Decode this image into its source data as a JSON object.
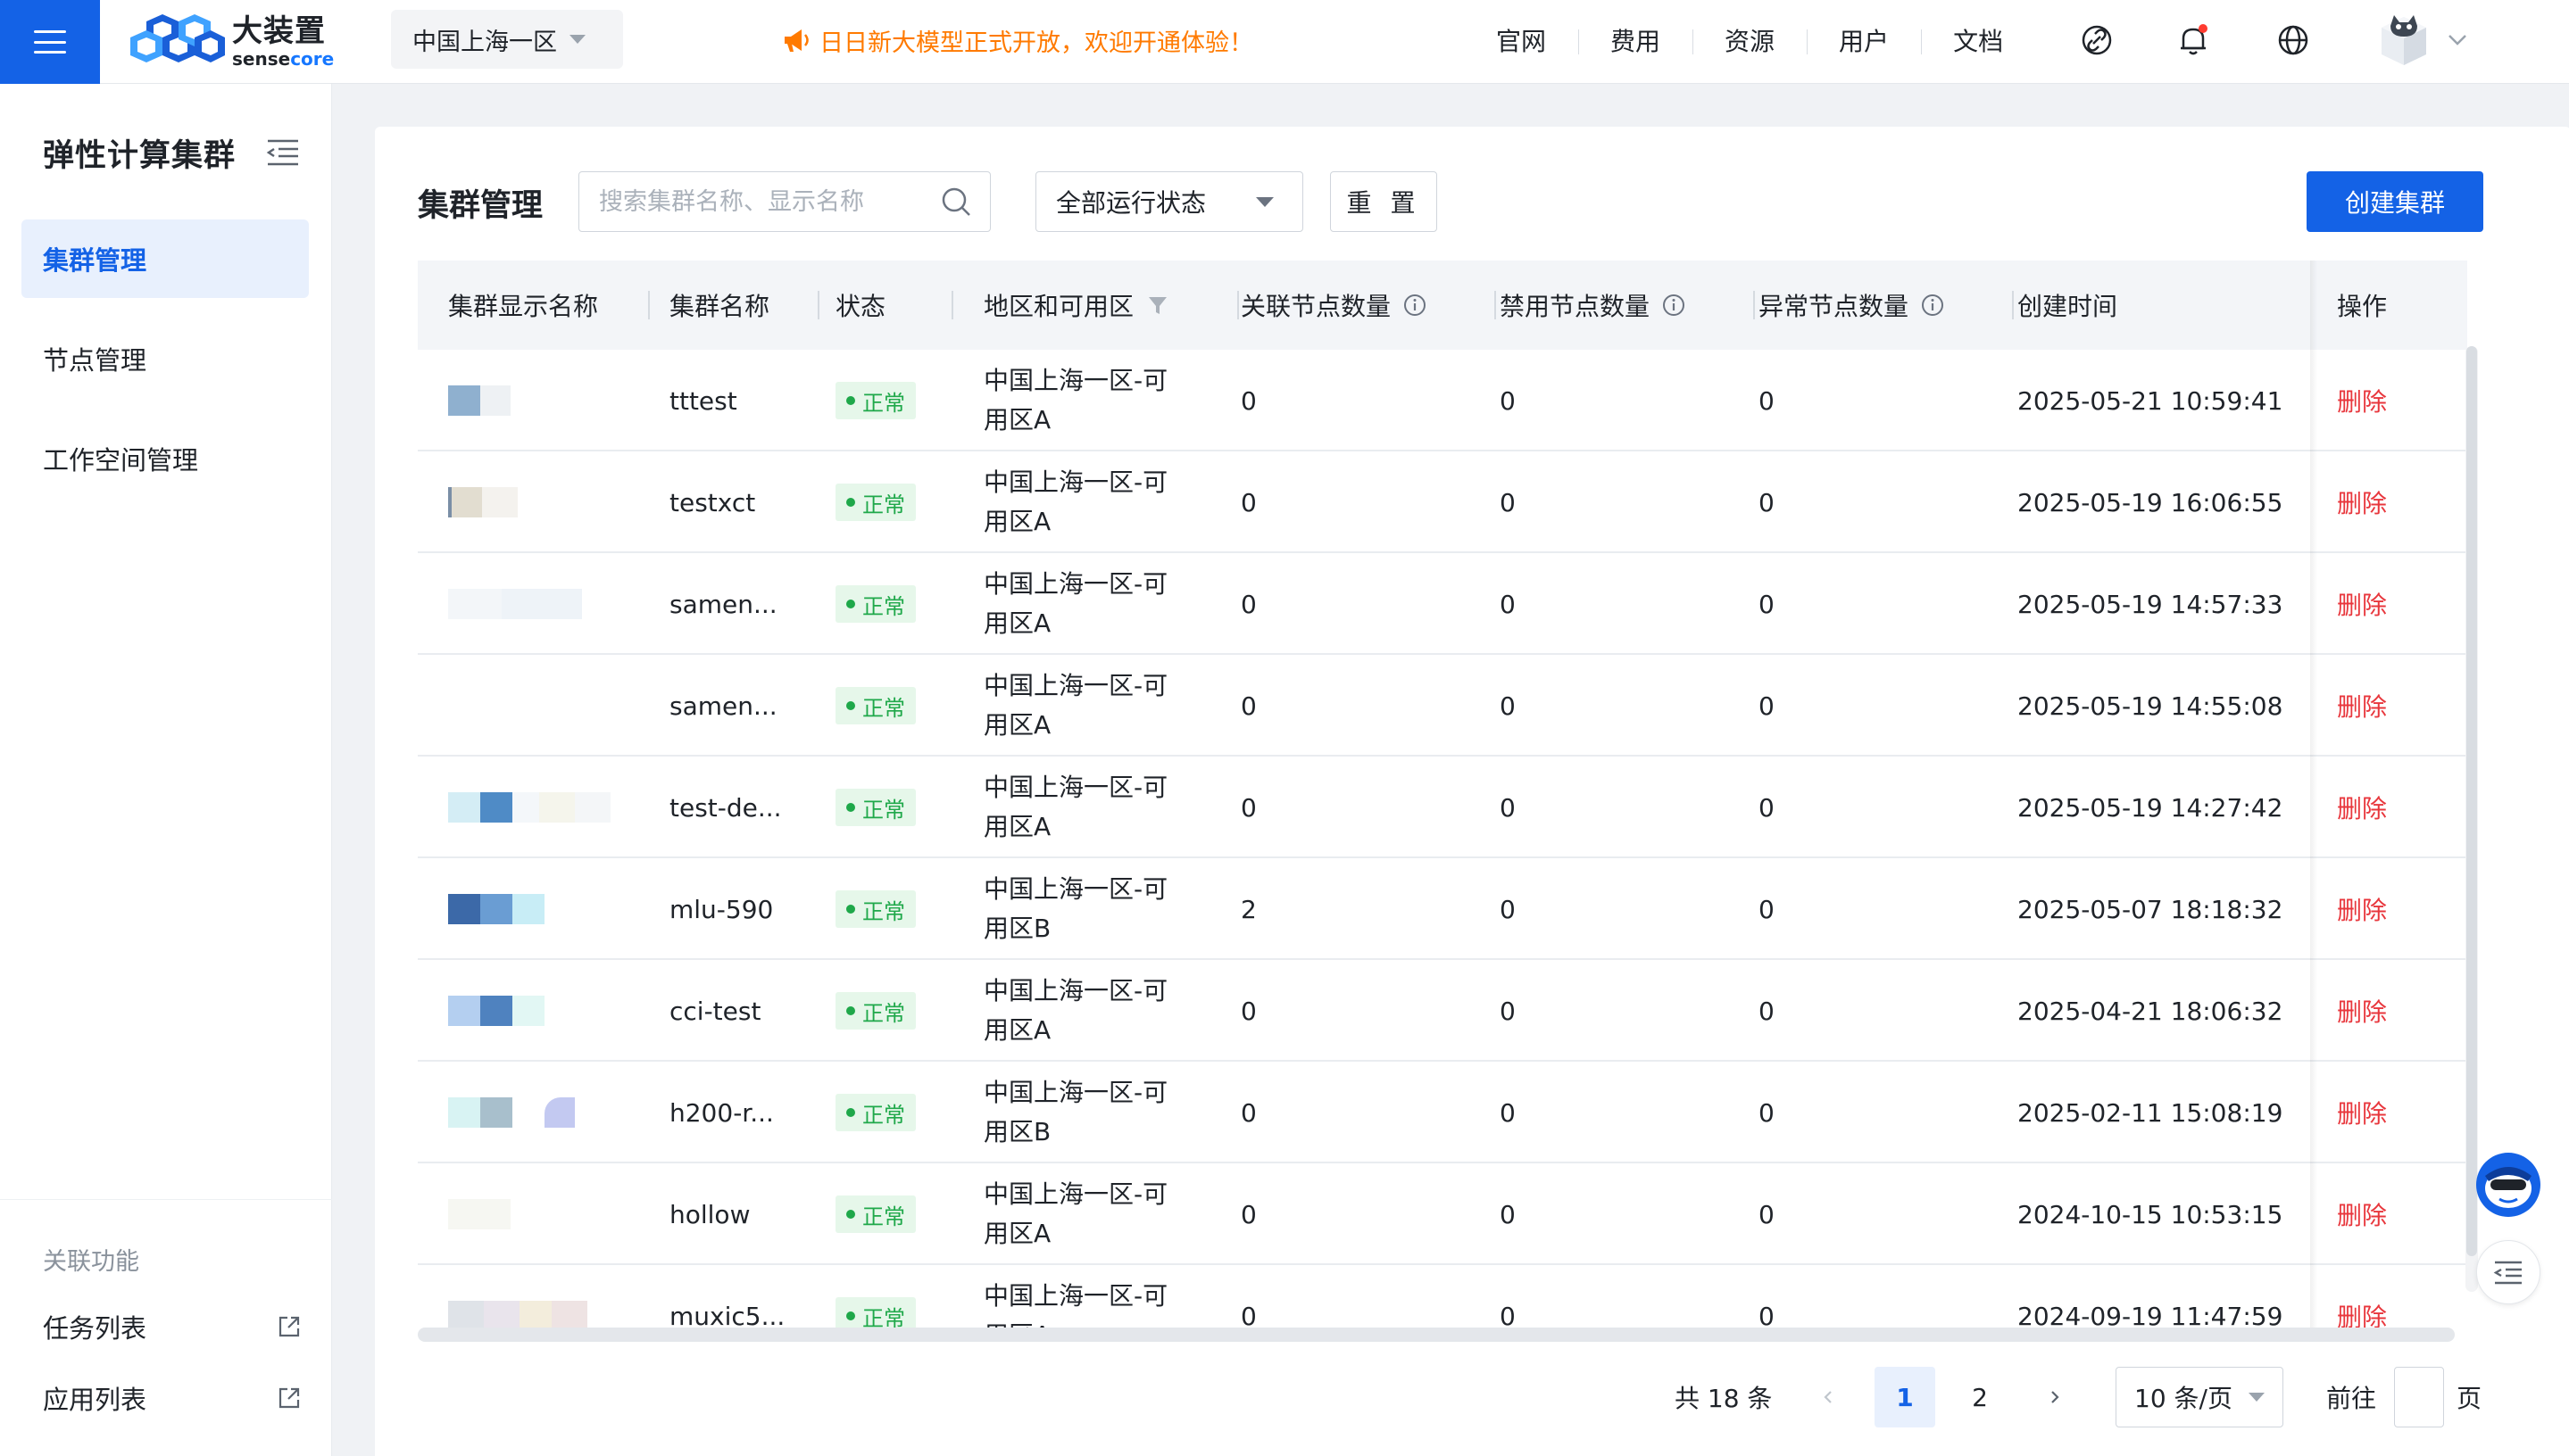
{
  "header": {
    "logo_cn": "大装置",
    "logo_en_a": "sense",
    "logo_en_b": "core",
    "region": "中国上海一区",
    "announcement": "日日新大模型正式开放，欢迎开通体验！",
    "nav": [
      "官网",
      "费用",
      "资源",
      "用户",
      "文档"
    ],
    "icons": [
      "menu-icon",
      "horn-icon",
      "link-icon",
      "bell-icon",
      "globe-icon",
      "avatar",
      "chevron-down-icon"
    ],
    "accent_color": "#1462e6",
    "notice_color": "#ff7a00"
  },
  "sidebar": {
    "title": "弹性计算集群",
    "items": [
      {
        "label": "集群管理",
        "active": true
      },
      {
        "label": "节点管理",
        "active": false
      },
      {
        "label": "工作空间管理",
        "active": false
      }
    ],
    "section_label": "关联功能",
    "links": [
      {
        "label": "任务列表"
      },
      {
        "label": "应用列表"
      }
    ]
  },
  "main": {
    "title": "集群管理",
    "search_placeholder": "搜索集群名称、显示名称",
    "status_filter": "全部运行状态",
    "reset_label": "重 置",
    "create_label": "创建集群",
    "columns": [
      "集群显示名称",
      "集群名称",
      "状态",
      "地区和可用区",
      "关联节点数量",
      "禁用节点数量",
      "异常节点数量",
      "创建时间",
      "操作"
    ],
    "delete_label": "删除",
    "status_color": "#1fa84a",
    "danger_color": "#e8373d",
    "rows": [
      {
        "name": "tttest",
        "status": "正常",
        "region": "中国上海一区-可\n用区A",
        "linked": "0",
        "disabled": "0",
        "abnormal": "0",
        "created": "2025-05-21 10:59:41"
      },
      {
        "name": "testxct",
        "status": "正常",
        "region": "中国上海一区-可\n用区A",
        "linked": "0",
        "disabled": "0",
        "abnormal": "0",
        "created": "2025-05-19 16:06:55"
      },
      {
        "name": "samen...",
        "status": "正常",
        "region": "中国上海一区-可\n用区A",
        "linked": "0",
        "disabled": "0",
        "abnormal": "0",
        "created": "2025-05-19 14:57:33"
      },
      {
        "name": "samen...",
        "status": "正常",
        "region": "中国上海一区-可\n用区A",
        "linked": "0",
        "disabled": "0",
        "abnormal": "0",
        "created": "2025-05-19 14:55:08"
      },
      {
        "name": "test-de...",
        "status": "正常",
        "region": "中国上海一区-可\n用区A",
        "linked": "0",
        "disabled": "0",
        "abnormal": "0",
        "created": "2025-05-19 14:27:42"
      },
      {
        "name": "mlu-590",
        "status": "正常",
        "region": "中国上海一区-可\n用区B",
        "linked": "2",
        "disabled": "0",
        "abnormal": "0",
        "created": "2025-05-07 18:18:32"
      },
      {
        "name": "cci-test",
        "status": "正常",
        "region": "中国上海一区-可\n用区A",
        "linked": "0",
        "disabled": "0",
        "abnormal": "0",
        "created": "2025-04-21 18:06:32"
      },
      {
        "name": "h200-r...",
        "status": "正常",
        "region": "中国上海一区-可\n用区B",
        "linked": "0",
        "disabled": "0",
        "abnormal": "0",
        "created": "2025-02-11 15:08:19"
      },
      {
        "name": "hollow",
        "status": "正常",
        "region": "中国上海一区-可\n用区A",
        "linked": "0",
        "disabled": "0",
        "abnormal": "0",
        "created": "2024-10-15 10:53:15"
      },
      {
        "name": "muxic5...",
        "status": "正常",
        "region": "中国上海一区-可\n用区A",
        "linked": "0",
        "disabled": "0",
        "abnormal": "0",
        "created": "2024-09-19 11:47:59"
      }
    ]
  },
  "pagination": {
    "total": "共 18 条",
    "pages": [
      "1",
      "2"
    ],
    "current": "1",
    "page_size": "10 条/页",
    "goto_label": "前往",
    "page_unit": "页"
  }
}
